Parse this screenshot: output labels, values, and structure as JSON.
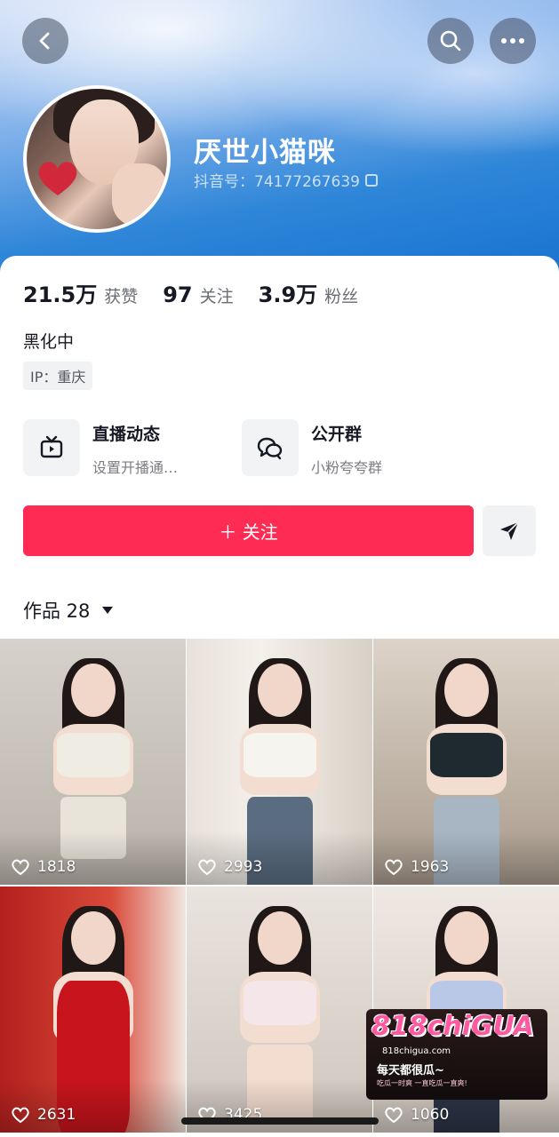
{
  "header": {
    "back_icon": "chevron-left-icon",
    "search_icon": "search-icon",
    "more_icon": "more-horizontal-icon"
  },
  "profile": {
    "nickname": "厌世小猫咪",
    "douyin_id": "抖音号：74177267639",
    "copy_icon": "copy-icon"
  },
  "stats": [
    {
      "value": "21.5万",
      "label": "获赞"
    },
    {
      "value": "97",
      "label": "关注"
    },
    {
      "value": "3.9万",
      "label": "粉丝"
    }
  ],
  "bio": "黑化中",
  "ip": "IP：重庆",
  "entries": [
    {
      "icon": "tv-icon",
      "title": "直播动态",
      "subtitle": "设置开播通…"
    },
    {
      "icon": "chat-bubbles-icon",
      "title": "公开群",
      "subtitle": "小粉夸夸群"
    }
  ],
  "actions": {
    "follow_label": "＋ 关注",
    "share_icon": "send-icon"
  },
  "works": {
    "tab_label": "作品 28",
    "items": [
      {
        "likes": "1818"
      },
      {
        "likes": "2993"
      },
      {
        "likes": "1963"
      },
      {
        "likes": "2631"
      },
      {
        "likes": "3425"
      },
      {
        "likes": "1060"
      }
    ]
  },
  "watermark": {
    "brand": "818chiGUA",
    "domain": "818chigua.com",
    "slogan": "每天都很瓜~",
    "small_text": "吃瓜一时爽 一直吃瓜一直爽!"
  },
  "colors": {
    "accent": "#fe2c55",
    "hero_blue": "#1570cf"
  }
}
